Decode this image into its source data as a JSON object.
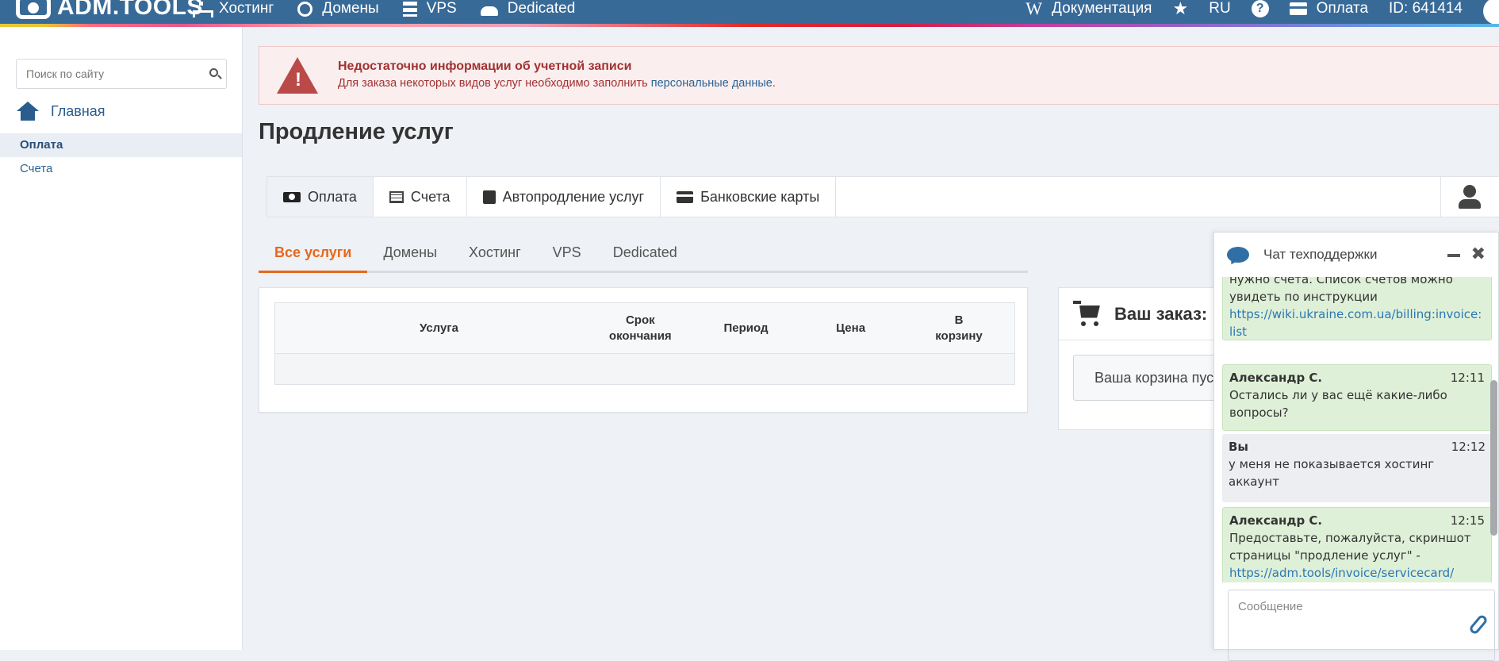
{
  "topbar": {
    "logo": "ADM.TOOLS",
    "nav": [
      "Хостинг",
      "Домены",
      "VPS",
      "Dedicated"
    ],
    "right": {
      "wiki_icon": "W",
      "docs": "Документация",
      "lang": "RU",
      "help_icon": "?",
      "pay": "Оплата",
      "id": "ID: 641414"
    }
  },
  "sidebar": {
    "search_placeholder": "Поиск по сайту",
    "home": "Главная",
    "items": [
      "Оплата",
      "Счета"
    ]
  },
  "alert": {
    "title": "Недостаточно информации об учетной записи",
    "text": "Для заказа некоторых видов услуг необходимо заполнить ",
    "link": "персональные данные",
    "text_end": ".",
    "icon_glyph": "!"
  },
  "page_title": "Продление услуг",
  "main_tabs": [
    "Оплата",
    "Счета",
    "Автопродление услуг",
    "Банковские карты"
  ],
  "sub_tabs": [
    "Все услуги",
    "Домены",
    "Хостинг",
    "VPS",
    "Dedicated"
  ],
  "table": {
    "columns": [
      "Услуга",
      "Срок окончания",
      "Период",
      "Цена",
      "В корзину"
    ]
  },
  "order": {
    "title": "Ваш заказ:",
    "empty": "Ваша корзина пуст"
  },
  "chat": {
    "title": "Чат техподдержки",
    "close_glyph": "✖",
    "messages": [
      {
        "text": "нужно счета. Список счетов можно увидеть по инструкции",
        "link": "https://wiki.ukraine.com.ua/billing:invoice:list"
      },
      {
        "who": "Александр С.",
        "time": "12:11",
        "text": "Остались ли у вас ещё какие-либо вопросы?"
      },
      {
        "who": "Вы",
        "time": "12:12",
        "text": "у меня не показывается хостинг аккаунт"
      },
      {
        "who": "Александр С.",
        "time": "12:15",
        "text": "Предоставьте, пожалуйста, скриншот страницы \"продление услуг\" -",
        "link": "https://adm.tools/invoice/servicecard/"
      }
    ],
    "input_placeholder": "Сообщение"
  },
  "colors": {
    "topbar": "#386a98",
    "accent_orange": "#e8671c",
    "alert_red": "#a13232",
    "link": "#2a6496",
    "chat_operator_bg": "#dff0d8"
  }
}
